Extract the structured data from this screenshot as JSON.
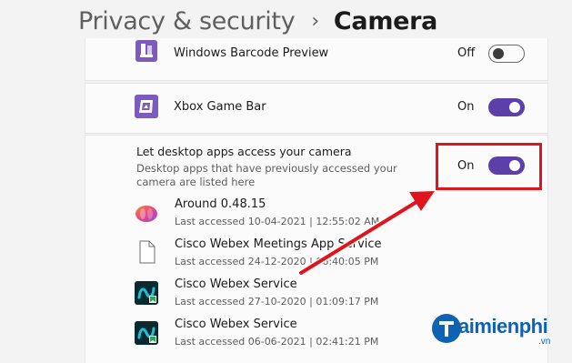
{
  "breadcrumb": {
    "parent": "Privacy & security",
    "separator": "›",
    "current": "Camera"
  },
  "apps_top": [
    {
      "name": "Windows Barcode Preview",
      "state": "Off",
      "icon": "barcode-preview-icon"
    },
    {
      "name": "Xbox Game Bar",
      "state": "On",
      "icon": "xbox-game-bar-icon"
    }
  ],
  "desktop_apps": {
    "title": "Let desktop apps access your camera",
    "description": "Desktop apps that have previously accessed your camera are listed here",
    "state": "On",
    "items": [
      {
        "name": "Around 0.48.15",
        "meta": "Last accessed 10-04-2021 | 12:55:02 AM",
        "icon": "around-app-icon"
      },
      {
        "name": "Cisco Webex Meetings App Service",
        "meta": "Last accessed 24-12-2020 | 06:40:05 PM",
        "icon": "file-icon"
      },
      {
        "name": "Cisco Webex Service",
        "meta": "Last accessed 27-10-2020 | 01:09:17 PM",
        "icon": "webex-icon"
      },
      {
        "name": "Cisco Webex Service",
        "meta": "Last accessed 06-06-2021 | 02:41:21 PM",
        "icon": "webex-icon"
      }
    ]
  },
  "watermark": {
    "brand": "aimienphi",
    "suffix": ".vn"
  },
  "colors": {
    "accent": "#5c3fa8",
    "annotation": "#e0141c",
    "brand": "#0e62b3"
  }
}
